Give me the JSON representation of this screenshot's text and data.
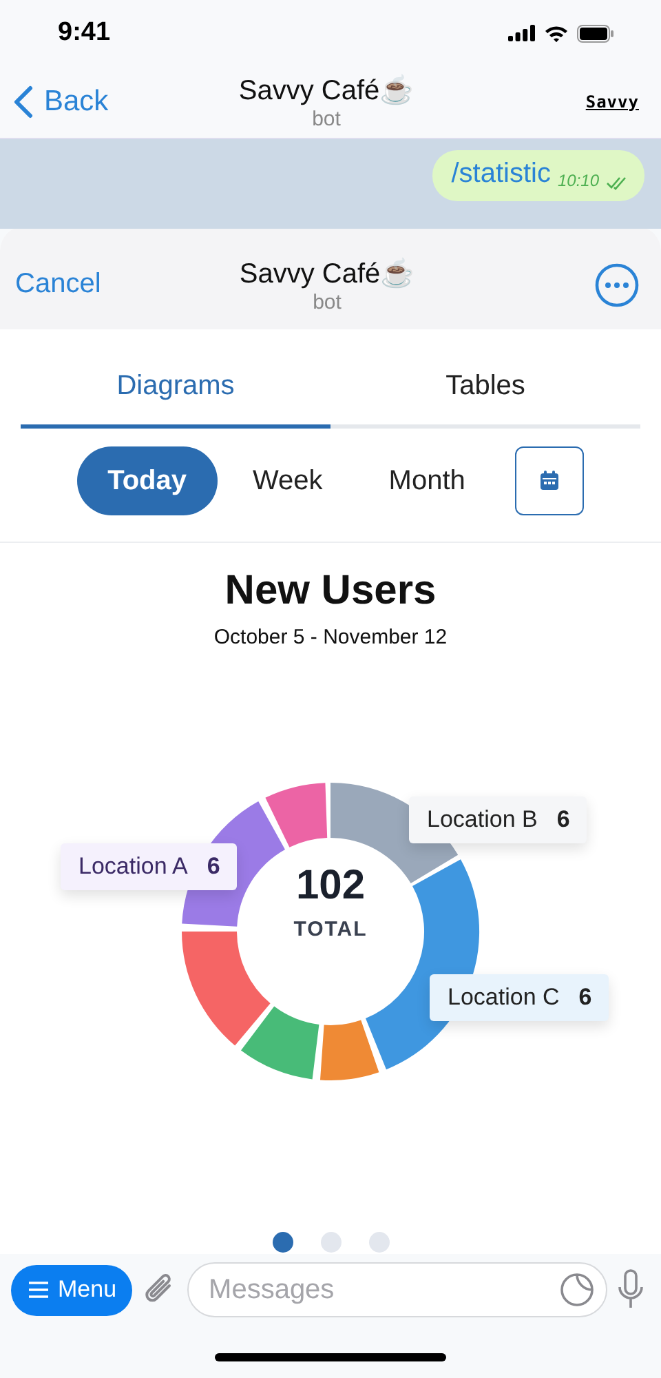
{
  "status_bar": {
    "time": "9:41"
  },
  "chat_header": {
    "back": "Back",
    "title": "Savvy Café☕",
    "subtitle": "bot",
    "logo": "Savvy"
  },
  "message": {
    "text": "/statistic",
    "time": "10:10",
    "read": true
  },
  "sheet": {
    "cancel": "Cancel",
    "title": "Savvy Café☕",
    "subtitle": "bot"
  },
  "tabs": [
    {
      "label": "Diagrams",
      "selected": true
    },
    {
      "label": "Tables",
      "selected": false
    }
  ],
  "periods": [
    {
      "label": "Today",
      "selected": true
    },
    {
      "label": "Week",
      "selected": false
    },
    {
      "label": "Month",
      "selected": false
    }
  ],
  "chart": {
    "title": "New Users",
    "range": "October 5 - November 12",
    "total": "102",
    "total_label": "TOTAL",
    "callouts": [
      {
        "label": "Location A",
        "value": "6",
        "color": "#f5f1fd"
      },
      {
        "label": "Location B",
        "value": "6",
        "color": "#f5f6f8"
      },
      {
        "label": "Location C",
        "value": "6",
        "color": "#e8f3fc"
      }
    ]
  },
  "pager": [
    {
      "selected": true
    },
    {
      "selected": false
    },
    {
      "selected": false
    }
  ],
  "composer": {
    "menu": "Menu",
    "placeholder": "Messages"
  }
}
